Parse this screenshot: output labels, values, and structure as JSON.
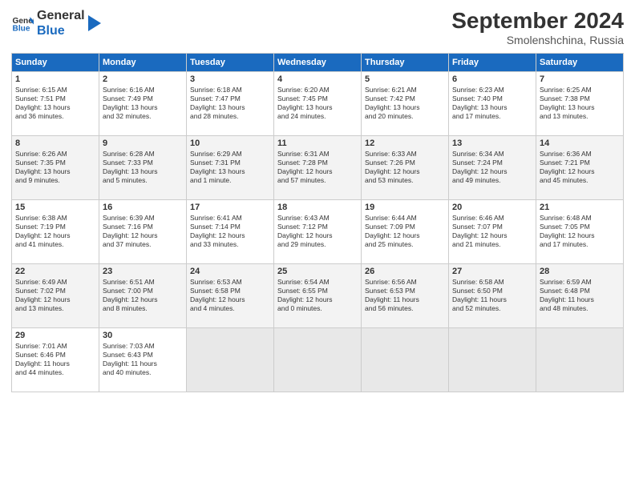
{
  "header": {
    "logo_line1": "General",
    "logo_line2": "Blue",
    "month": "September 2024",
    "location": "Smolenshchina, Russia"
  },
  "days_of_week": [
    "Sunday",
    "Monday",
    "Tuesday",
    "Wednesday",
    "Thursday",
    "Friday",
    "Saturday"
  ],
  "weeks": [
    [
      {
        "day": "1",
        "info": "Sunrise: 6:15 AM\nSunset: 7:51 PM\nDaylight: 13 hours\nand 36 minutes."
      },
      {
        "day": "2",
        "info": "Sunrise: 6:16 AM\nSunset: 7:49 PM\nDaylight: 13 hours\nand 32 minutes."
      },
      {
        "day": "3",
        "info": "Sunrise: 6:18 AM\nSunset: 7:47 PM\nDaylight: 13 hours\nand 28 minutes."
      },
      {
        "day": "4",
        "info": "Sunrise: 6:20 AM\nSunset: 7:45 PM\nDaylight: 13 hours\nand 24 minutes."
      },
      {
        "day": "5",
        "info": "Sunrise: 6:21 AM\nSunset: 7:42 PM\nDaylight: 13 hours\nand 20 minutes."
      },
      {
        "day": "6",
        "info": "Sunrise: 6:23 AM\nSunset: 7:40 PM\nDaylight: 13 hours\nand 17 minutes."
      },
      {
        "day": "7",
        "info": "Sunrise: 6:25 AM\nSunset: 7:38 PM\nDaylight: 13 hours\nand 13 minutes."
      }
    ],
    [
      {
        "day": "8",
        "info": "Sunrise: 6:26 AM\nSunset: 7:35 PM\nDaylight: 13 hours\nand 9 minutes."
      },
      {
        "day": "9",
        "info": "Sunrise: 6:28 AM\nSunset: 7:33 PM\nDaylight: 13 hours\nand 5 minutes."
      },
      {
        "day": "10",
        "info": "Sunrise: 6:29 AM\nSunset: 7:31 PM\nDaylight: 13 hours\nand 1 minute."
      },
      {
        "day": "11",
        "info": "Sunrise: 6:31 AM\nSunset: 7:28 PM\nDaylight: 12 hours\nand 57 minutes."
      },
      {
        "day": "12",
        "info": "Sunrise: 6:33 AM\nSunset: 7:26 PM\nDaylight: 12 hours\nand 53 minutes."
      },
      {
        "day": "13",
        "info": "Sunrise: 6:34 AM\nSunset: 7:24 PM\nDaylight: 12 hours\nand 49 minutes."
      },
      {
        "day": "14",
        "info": "Sunrise: 6:36 AM\nSunset: 7:21 PM\nDaylight: 12 hours\nand 45 minutes."
      }
    ],
    [
      {
        "day": "15",
        "info": "Sunrise: 6:38 AM\nSunset: 7:19 PM\nDaylight: 12 hours\nand 41 minutes."
      },
      {
        "day": "16",
        "info": "Sunrise: 6:39 AM\nSunset: 7:16 PM\nDaylight: 12 hours\nand 37 minutes."
      },
      {
        "day": "17",
        "info": "Sunrise: 6:41 AM\nSunset: 7:14 PM\nDaylight: 12 hours\nand 33 minutes."
      },
      {
        "day": "18",
        "info": "Sunrise: 6:43 AM\nSunset: 7:12 PM\nDaylight: 12 hours\nand 29 minutes."
      },
      {
        "day": "19",
        "info": "Sunrise: 6:44 AM\nSunset: 7:09 PM\nDaylight: 12 hours\nand 25 minutes."
      },
      {
        "day": "20",
        "info": "Sunrise: 6:46 AM\nSunset: 7:07 PM\nDaylight: 12 hours\nand 21 minutes."
      },
      {
        "day": "21",
        "info": "Sunrise: 6:48 AM\nSunset: 7:05 PM\nDaylight: 12 hours\nand 17 minutes."
      }
    ],
    [
      {
        "day": "22",
        "info": "Sunrise: 6:49 AM\nSunset: 7:02 PM\nDaylight: 12 hours\nand 13 minutes."
      },
      {
        "day": "23",
        "info": "Sunrise: 6:51 AM\nSunset: 7:00 PM\nDaylight: 12 hours\nand 8 minutes."
      },
      {
        "day": "24",
        "info": "Sunrise: 6:53 AM\nSunset: 6:58 PM\nDaylight: 12 hours\nand 4 minutes."
      },
      {
        "day": "25",
        "info": "Sunrise: 6:54 AM\nSunset: 6:55 PM\nDaylight: 12 hours\nand 0 minutes."
      },
      {
        "day": "26",
        "info": "Sunrise: 6:56 AM\nSunset: 6:53 PM\nDaylight: 11 hours\nand 56 minutes."
      },
      {
        "day": "27",
        "info": "Sunrise: 6:58 AM\nSunset: 6:50 PM\nDaylight: 11 hours\nand 52 minutes."
      },
      {
        "day": "28",
        "info": "Sunrise: 6:59 AM\nSunset: 6:48 PM\nDaylight: 11 hours\nand 48 minutes."
      }
    ],
    [
      {
        "day": "29",
        "info": "Sunrise: 7:01 AM\nSunset: 6:46 PM\nDaylight: 11 hours\nand 44 minutes."
      },
      {
        "day": "30",
        "info": "Sunrise: 7:03 AM\nSunset: 6:43 PM\nDaylight: 11 hours\nand 40 minutes."
      },
      {
        "day": "",
        "info": ""
      },
      {
        "day": "",
        "info": ""
      },
      {
        "day": "",
        "info": ""
      },
      {
        "day": "",
        "info": ""
      },
      {
        "day": "",
        "info": ""
      }
    ]
  ]
}
